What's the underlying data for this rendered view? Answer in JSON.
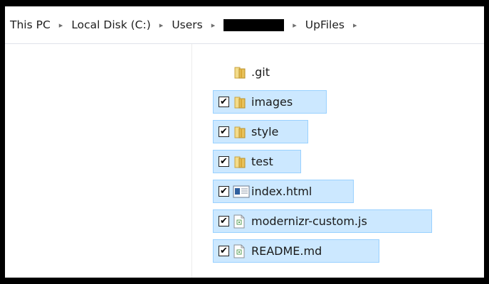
{
  "breadcrumb": {
    "items": [
      "This PC",
      "Local Disk (C:)",
      "Users",
      "UpFiles"
    ],
    "separator": "▸"
  },
  "files": [
    {
      "name": ".git",
      "type": "folder",
      "checked": false,
      "selected": false
    },
    {
      "name": "images",
      "type": "folder",
      "checked": true,
      "selected": true
    },
    {
      "name": "style",
      "type": "folder",
      "checked": true,
      "selected": true
    },
    {
      "name": "test",
      "type": "folder",
      "checked": true,
      "selected": true
    },
    {
      "name": "index.html",
      "type": "html-file",
      "checked": true,
      "selected": true
    },
    {
      "name": "modernizr-custom.js",
      "type": "script-file",
      "checked": true,
      "selected": true
    },
    {
      "name": "README.md",
      "type": "text-file",
      "checked": true,
      "selected": true
    }
  ],
  "checkmark": "✔",
  "colors": {
    "selection_bg": "#cce8ff",
    "selection_border": "#99d1ff",
    "folder": "#e8c15a"
  },
  "icons": {
    "folder": "folder-icon",
    "html-file": "html-file-icon",
    "script-file": "script-file-icon",
    "text-file": "text-file-icon"
  }
}
